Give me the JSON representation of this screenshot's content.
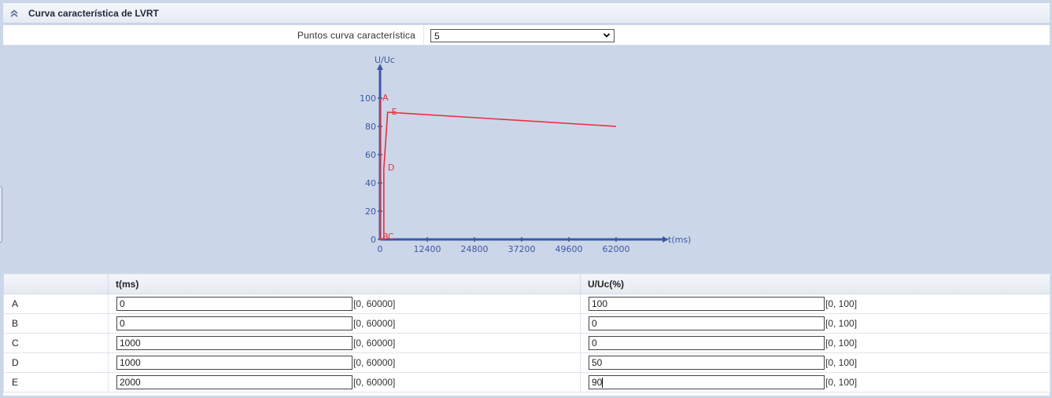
{
  "panel": {
    "title": "Curva característica de LVRT"
  },
  "points": {
    "label": "Puntos curva característica",
    "selected": "5"
  },
  "chart_data": {
    "type": "line",
    "ylabel": "U/Uc",
    "xlabel": "t(ms)",
    "x_ticks": [
      "0",
      "12400",
      "24800",
      "37200",
      "49600",
      "62000"
    ],
    "y_ticks": [
      "0",
      "20",
      "40",
      "60",
      "80",
      "100"
    ],
    "xlim": [
      0,
      72000
    ],
    "ylim": [
      0,
      120
    ],
    "series": [
      {
        "points": [
          {
            "label": "A",
            "x": 0,
            "y": 100
          },
          {
            "label": "B",
            "x": 0,
            "y": 0
          },
          {
            "label": "C",
            "x": 1000,
            "y": 0
          },
          {
            "label": "D",
            "x": 1000,
            "y": 50
          },
          {
            "label": "E",
            "x": 2000,
            "y": 90
          },
          {
            "label": "",
            "x": 62000,
            "y": 80
          }
        ]
      }
    ],
    "line_color": "#e8303a",
    "axis_color": "#3b59a3"
  },
  "table": {
    "headers": [
      "",
      "t(ms)",
      "U/Uc(%)"
    ],
    "rows": [
      {
        "name": "A",
        "t": "0",
        "t_range": "[0, 60000]",
        "u": "100",
        "u_range": "[0, 100]"
      },
      {
        "name": "B",
        "t": "0",
        "t_range": "[0, 60000]",
        "u": "0",
        "u_range": "[0, 100]"
      },
      {
        "name": "C",
        "t": "1000",
        "t_range": "[0, 60000]",
        "u": "0",
        "u_range": "[0, 100]"
      },
      {
        "name": "D",
        "t": "1000",
        "t_range": "[0, 60000]",
        "u": "50",
        "u_range": "[0, 100]"
      },
      {
        "name": "E",
        "t": "2000",
        "t_range": "[0, 60000]",
        "u": "90",
        "u_range": "[0, 100]"
      }
    ]
  }
}
